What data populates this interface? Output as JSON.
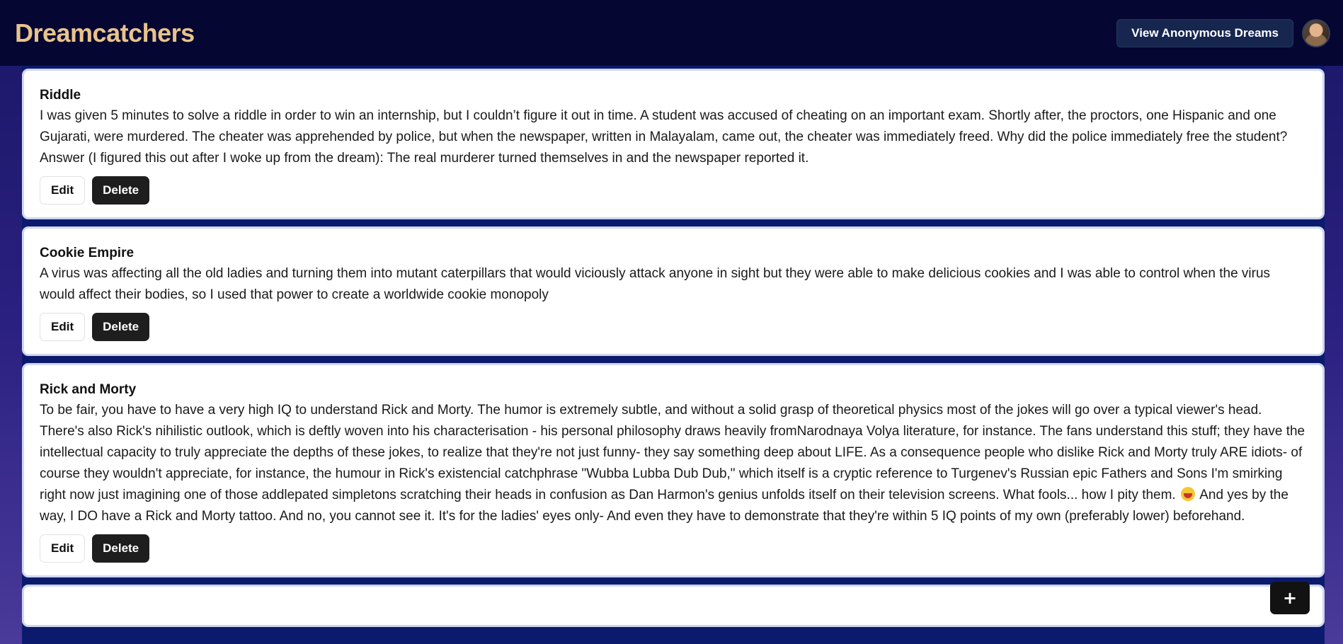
{
  "header": {
    "brand": "Dreamcatchers",
    "anonymous_button": "View Anonymous Dreams",
    "avatar_alt": "avatar"
  },
  "dreams": [
    {
      "title": "Riddle",
      "body": "I was given 5 minutes to solve a riddle in order to win an internship, but I couldn’t figure it out in time. A student was accused of cheating on an important exam. Shortly after, the proctors, one Hispanic and one Gujarati, were murdered. The cheater was apprehended by police, but when the newspaper, written in Malayalam, came out, the cheater was immediately freed. Why did the police immediately free the student? Answer (I figured this out after I woke up from the dream): The real murderer turned themselves in and the newspaper reported it.",
      "edit_label": "Edit",
      "delete_label": "Delete"
    },
    {
      "title": "Cookie Empire",
      "body": "A virus was affecting all the old ladies and turning them into mutant caterpillars that would viciously attack anyone in sight but they were able to make delicious cookies and I was able to control when the virus would affect their bodies, so I used that power to create a worldwide cookie monopoly",
      "edit_label": "Edit",
      "delete_label": "Delete"
    },
    {
      "title": "Rick and Morty",
      "body_part1": "To be fair, you have to have a very high IQ to understand Rick and Morty. The humor is extremely subtle, and without a solid grasp of theoretical physics most of the jokes will go over a typical viewer's head. There's also Rick's nihilistic outlook, which is deftly woven into his characterisation - his personal philosophy draws heavily fromNarodnaya Volya literature, for instance. The fans understand this stuff; they have the intellectual capacity to truly appreciate the depths of these jokes, to realize that they're not just funny- they say something deep about LIFE. As a consequence people who dislike Rick and Morty truly ARE idiots- of course they wouldn't appreciate, for instance, the humour in Rick's existencial catchphrase \"Wubba Lubba Dub Dub,\" which itself is a cryptic reference to Turgenev's Russian epic Fathers and Sons I'm smirking right now just imagining one of those addlepated simpletons scratching their heads in confusion as Dan Harmon's genius unfolds itself on their television screens. What fools... how I pity them.",
      "body_part2": "And yes by the way, I DO have a Rick and Morty tattoo. And no, you cannot see it. It's for the ladies' eyes only- And even they have to demonstrate that they're within 5 IQ points of my own (preferably lower) beforehand.",
      "edit_label": "Edit",
      "delete_label": "Delete"
    }
  ],
  "fab": {
    "label": "+"
  }
}
